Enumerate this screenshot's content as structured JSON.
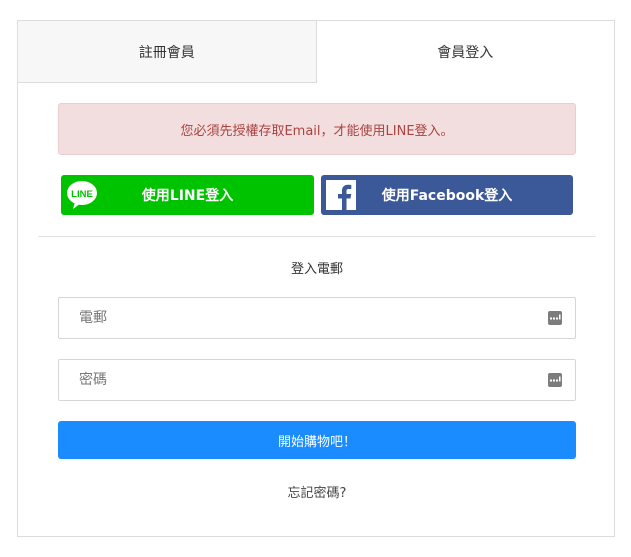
{
  "tabs": [
    {
      "label": "註冊會員",
      "active": false
    },
    {
      "label": "會員登入",
      "active": true
    }
  ],
  "alert": {
    "text": "您必須先授權存取Email，才能使用LINE登入。"
  },
  "social": {
    "line_label": "使用LINE登入",
    "line_logo_text": "LINE",
    "facebook_label": "使用Facebook登入"
  },
  "section_title": "登入電郵",
  "form": {
    "email_placeholder": "電郵",
    "password_placeholder": "密碼",
    "submit_label": "開始購物吧！"
  },
  "forgot_label": "忘記密碼?",
  "colors": {
    "line_green": "#00c300",
    "facebook_blue": "#3b5998",
    "submit_blue": "#1a8cff",
    "alert_bg": "#f2dede",
    "alert_text": "#a94442"
  }
}
